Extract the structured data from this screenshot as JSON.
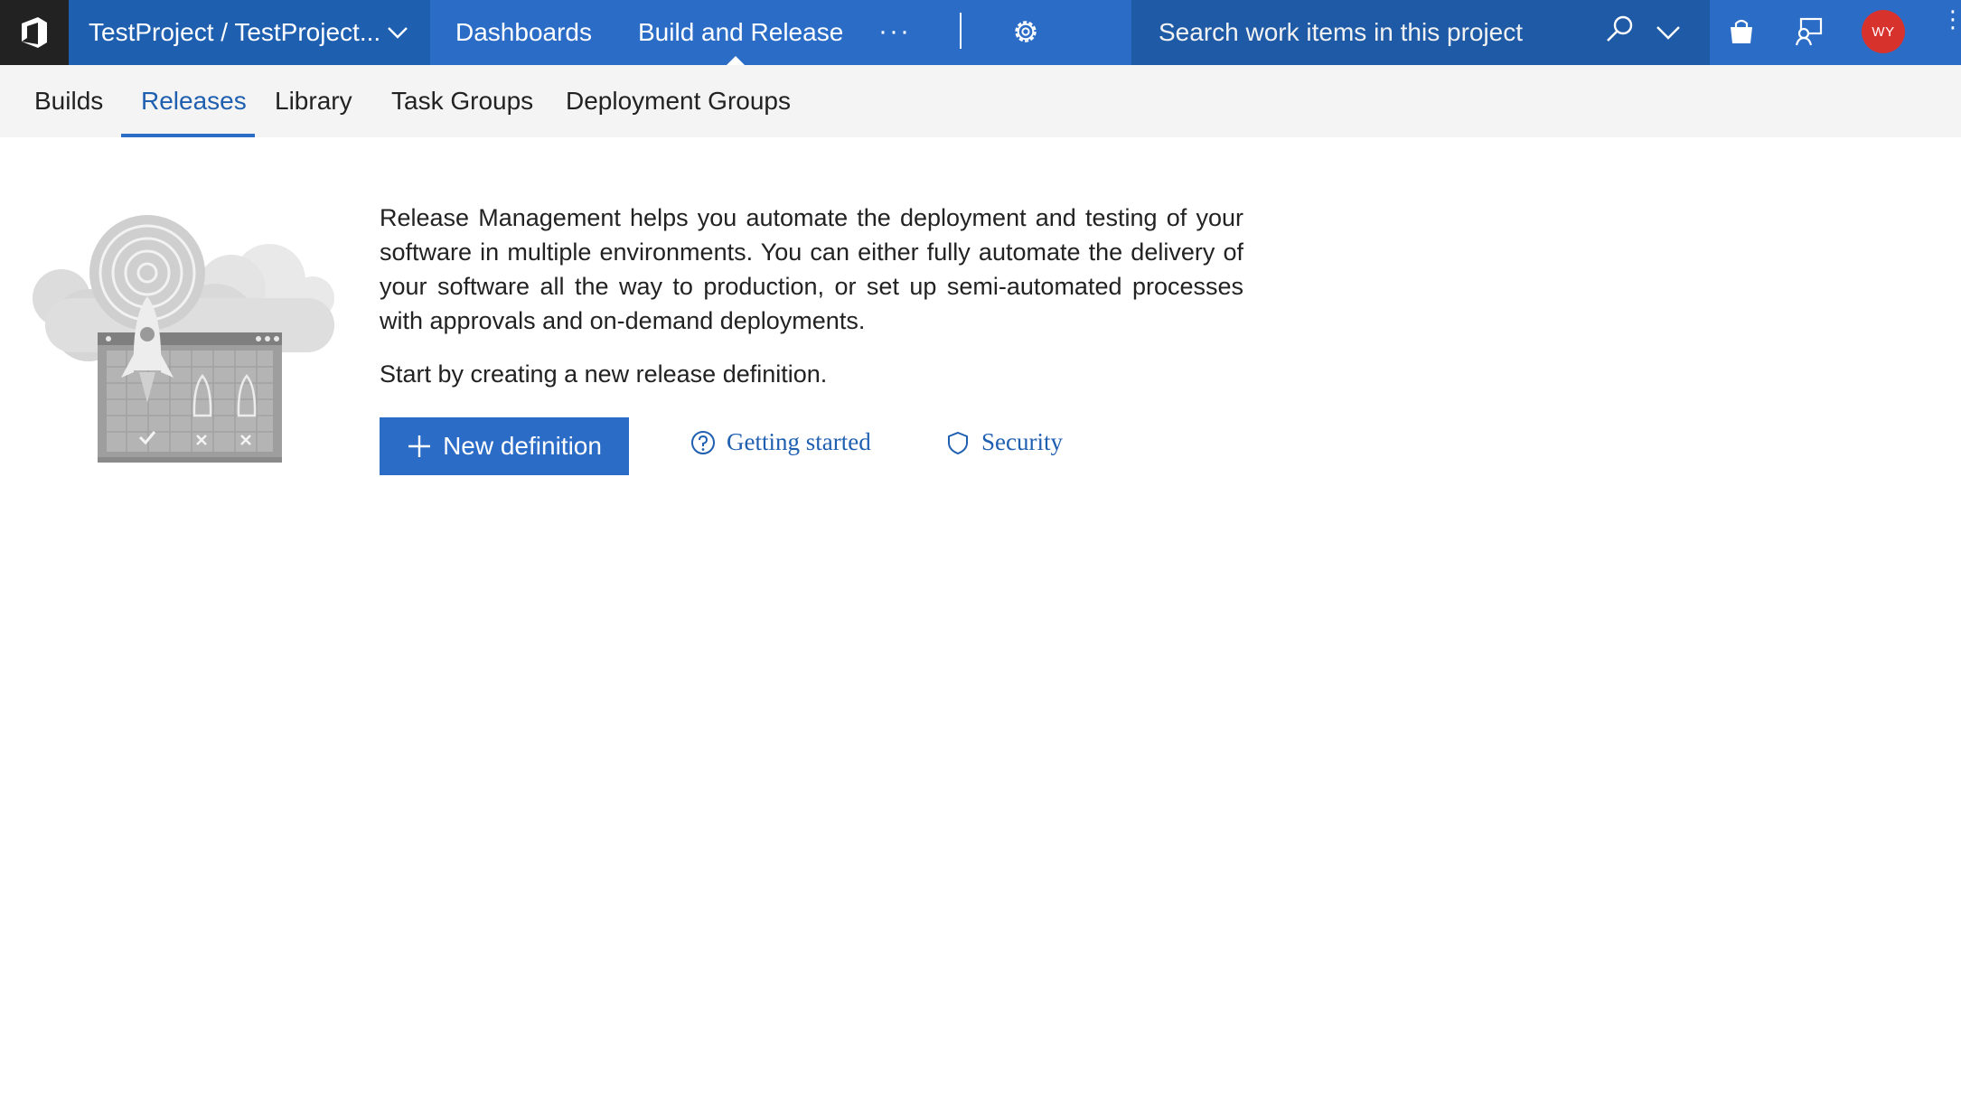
{
  "header": {
    "project_title": "TestProject / TestProject...",
    "nav": {
      "dashboards": "Dashboards",
      "build_release": "Build and Release",
      "more": "···"
    },
    "search_placeholder": "Search work items in this project",
    "user_initials": "WY",
    "colors": {
      "bar": "#2b6cc7",
      "project_bg": "#1f5fb0",
      "search_bg": "#1e5aa6",
      "avatar": "#d8322d"
    }
  },
  "subnav": {
    "tabs": [
      "Builds",
      "Releases",
      "Library",
      "Task Groups",
      "Deployment Groups"
    ],
    "active": "Releases"
  },
  "main": {
    "description": "Release Management helps you automate the deployment and testing of your software in multiple environments. You can either fully automate the delivery of your software all the way to production, or set up semi-automated processes with approvals and on-demand deployments.",
    "start_text": "Start by creating a new release definition.",
    "new_definition_label": "New definition",
    "getting_started_label": "Getting started",
    "security_label": "Security"
  },
  "icons": [
    "vsts-logo-icon",
    "chevron-down-icon",
    "gear-icon",
    "search-icon",
    "shopping-bag-icon",
    "feedback-icon",
    "plus-icon",
    "question-circle-icon",
    "shield-icon",
    "rocket-illustration"
  ]
}
